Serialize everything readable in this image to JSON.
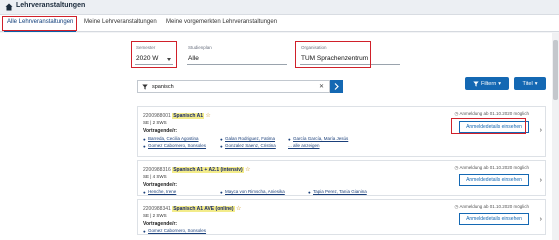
{
  "topbar": {
    "title": "Lehrveranstaltungen"
  },
  "tabs": [
    {
      "label": "Alle Lehrveranstaltungen"
    },
    {
      "label": "Meine Lehrveranstaltungen"
    },
    {
      "label": "Meine vorgemerkten Lehrveranstaltungen"
    }
  ],
  "filters": {
    "semester": {
      "label": "Semester",
      "value": "2020 W"
    },
    "studienplan": {
      "label": "Studienplan",
      "value": "Alle"
    },
    "organisation": {
      "label": "Organisation",
      "value": "TUM Sprachenzentrum"
    }
  },
  "search": {
    "value": "spanisch"
  },
  "buttons": {
    "filter_label": "Filtern",
    "titel_label": "Titel"
  },
  "courses": [
    {
      "code": "2200988001",
      "name": "Spanisch A1",
      "meta": "SE | 2 SWS",
      "lecturers_label": "Vortragende/r:",
      "lecturers": [
        "Barreda, Cecilia Agostina",
        "Galan Rodriguez, Fatima",
        "García García, María Jesús",
        "Gomez Cabornero, Sonsoles",
        "Gonzalez Saenz, Cristina",
        "... alle anzeigen"
      ],
      "registration": "Anmeldung ab 01.10.2020 möglich",
      "button": "Anmeldedetails einsehen"
    },
    {
      "code": "2200988316",
      "name": "Spanisch A1 + A2.1 (intensiv)",
      "meta": "SE | 4 SWS",
      "lecturers_label": "Vortragende/r:",
      "lecturers": [
        "Henche, Irene",
        "Mayca von Rimscha, Aniesika",
        "Tapia Perez, Tania Gianina"
      ],
      "registration": "Anmeldung ab 01.10.2020 möglich",
      "button": "Anmeldedetails einsehen"
    },
    {
      "code": "2200988341",
      "name": "Spanisch A1 AVE (online)",
      "meta": "SE | 2 SWS",
      "lecturers_label": "Vortragende/r:",
      "lecturers": [
        "Gomez Cabornero, Sonsoles"
      ],
      "registration": "Anmeldung ab 01.10.2020 möglich",
      "button": "Anmeldedetails einsehen"
    }
  ],
  "colors": {
    "accent": "#1468b3",
    "highlight": "#d0202a"
  }
}
